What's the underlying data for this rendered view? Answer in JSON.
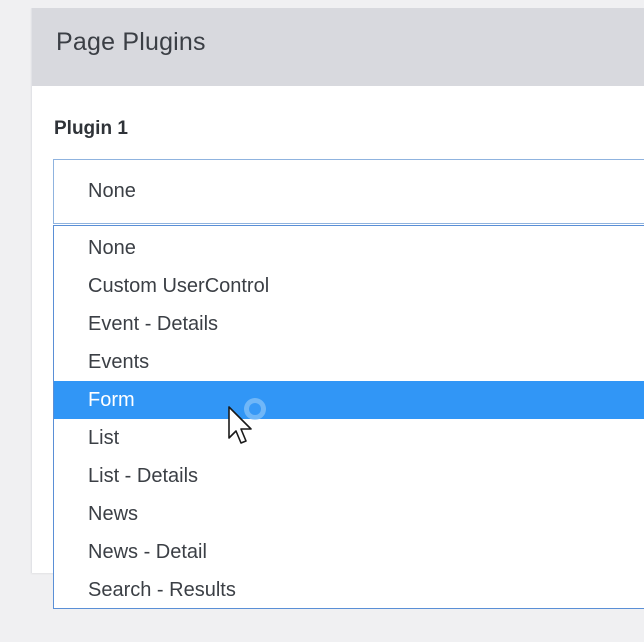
{
  "panel": {
    "title": "Page Plugins"
  },
  "plugin1": {
    "label": "Plugin 1",
    "selected_value": "None",
    "options": [
      {
        "label": "None"
      },
      {
        "label": "Custom UserControl"
      },
      {
        "label": "Event - Details"
      },
      {
        "label": "Events"
      },
      {
        "label": "Form"
      },
      {
        "label": "List"
      },
      {
        "label": "List - Details"
      },
      {
        "label": "News"
      },
      {
        "label": "News - Detail"
      },
      {
        "label": "Search - Results"
      }
    ],
    "highlighted_option": "Form"
  },
  "colors": {
    "highlight": "#3196f6",
    "header_bg": "#d8d9de",
    "border": "#5a8fd6"
  },
  "icons": {
    "cursor": "arrow-cursor-icon"
  }
}
